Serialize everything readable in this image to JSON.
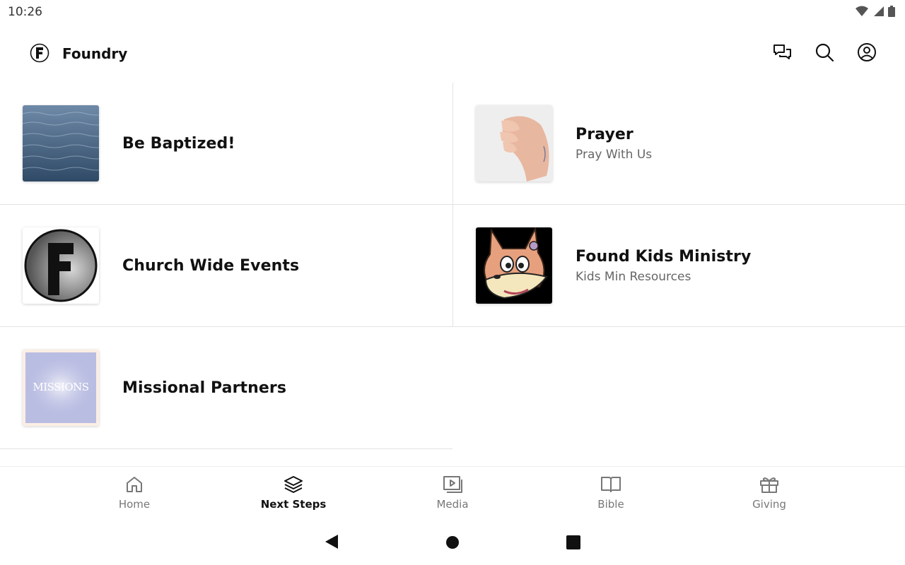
{
  "status": {
    "time": "10:26"
  },
  "app": {
    "title": "Foundry"
  },
  "items": [
    {
      "title": "Be Baptized!",
      "subtitle": ""
    },
    {
      "title": "Prayer",
      "subtitle": "Pray With Us"
    },
    {
      "title": "Church Wide Events",
      "subtitle": ""
    },
    {
      "title": "Found Kids Ministry",
      "subtitle": "Kids Min Resources"
    },
    {
      "title": "Missional Partners",
      "subtitle": "",
      "thumb_text": "MISSIONS"
    }
  ],
  "nav": [
    {
      "label": "Home",
      "icon": "home-icon"
    },
    {
      "label": "Next Steps",
      "icon": "layers-icon"
    },
    {
      "label": "Media",
      "icon": "media-icon"
    },
    {
      "label": "Bible",
      "icon": "book-icon"
    },
    {
      "label": "Giving",
      "icon": "gift-icon"
    }
  ],
  "nav_active": "Next Steps",
  "colors": {
    "accent": "#111111",
    "inactive": "#777777",
    "divider": "#e3e3e3"
  }
}
